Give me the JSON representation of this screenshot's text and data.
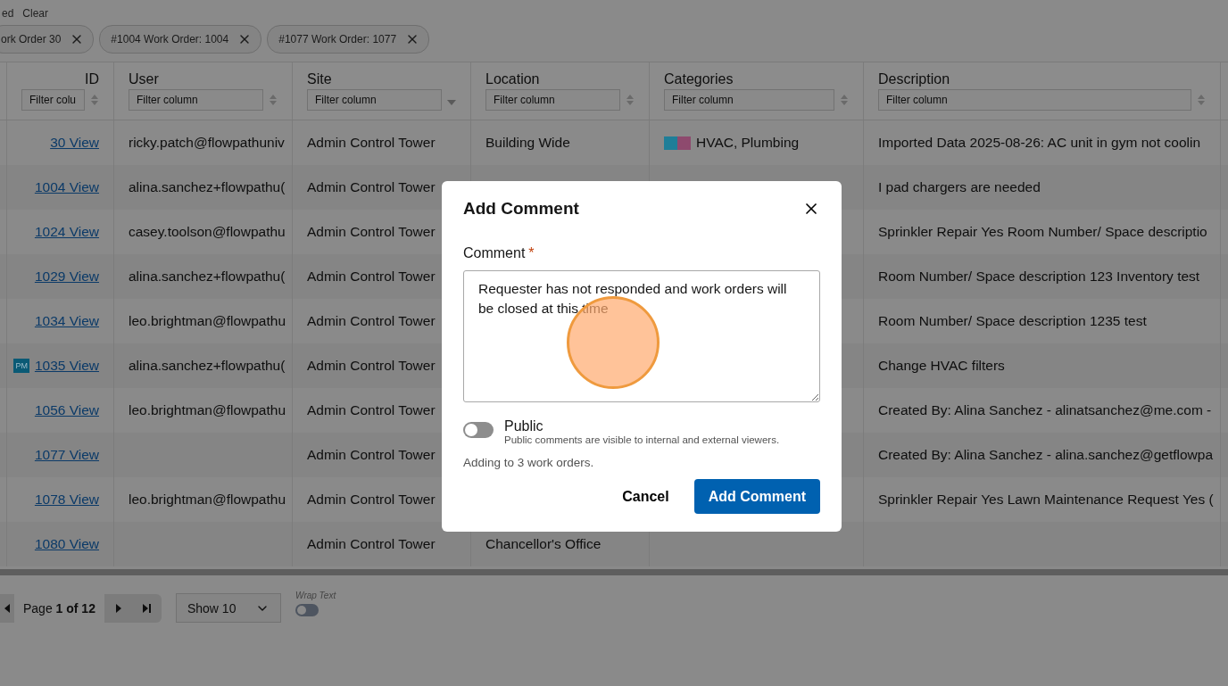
{
  "filter_bar": {
    "label": "ed",
    "clear": "Clear",
    "chips": [
      {
        "label": "ork Order 30"
      },
      {
        "label": "#1004 Work Order: 1004"
      },
      {
        "label": "#1077 Work Order: 1077"
      }
    ]
  },
  "table": {
    "columns": [
      {
        "label": "ID",
        "placeholder": "Filter colu",
        "sorted": false
      },
      {
        "label": "User",
        "placeholder": "Filter column",
        "sorted": false
      },
      {
        "label": "Site",
        "placeholder": "Filter column",
        "sorted": true
      },
      {
        "label": "Location",
        "placeholder": "Filter column",
        "sorted": false
      },
      {
        "label": "Categories",
        "placeholder": "Filter column",
        "sorted": false
      },
      {
        "label": "Description",
        "placeholder": "Filter column",
        "sorted": false
      }
    ],
    "rows": [
      {
        "id": "30 View",
        "user": "ricky.patch@flowpathuniv",
        "site": "Admin Control Tower",
        "location": "Building Wide",
        "categories": {
          "label": "HVAC, Plumbing",
          "swatches": [
            {
              "color": "#1f7e98"
            },
            {
              "color": "#8e4a6e"
            }
          ]
        },
        "description": "Imported Data 2025-08-26: AC unit in gym not coolin"
      },
      {
        "id": "1004 View",
        "user": "alina.sanchez+flowpathu(",
        "site": "Admin Control Tower",
        "description": "I pad chargers are needed"
      },
      {
        "id": "1024 View",
        "user": "casey.toolson@flowpathu",
        "site": "Admin Control Tower",
        "description": "Sprinkler Repair Yes Room Number/ Space descriptio"
      },
      {
        "id": "1029 View",
        "user": "alina.sanchez+flowpathu(",
        "site": "Admin Control Tower",
        "description": "Room Number/ Space description 123 Inventory test"
      },
      {
        "id": "1034 View",
        "user": "leo.brightman@flowpathu",
        "site": "Admin Control Tower",
        "description": "Room Number/ Space description 1235 test"
      },
      {
        "id": "1035 View",
        "badge": "PM",
        "user": "alina.sanchez+flowpathu(",
        "site": "Admin Control Tower",
        "description": "Change HVAC filters"
      },
      {
        "id": "1056 View",
        "user": "leo.brightman@flowpathu",
        "site": "Admin Control Tower",
        "description": "Created By: Alina Sanchez - alinatsanchez@me.com -"
      },
      {
        "id": "1077 View",
        "site": "Admin Control Tower",
        "description": "Created By: Alina Sanchez - alina.sanchez@getflowpa"
      },
      {
        "id": "1078 View",
        "user": "leo.brightman@flowpathu",
        "site": "Admin Control Tower",
        "description": "Sprinkler Repair Yes Lawn Maintenance Request Yes ("
      },
      {
        "id": "1080 View",
        "site": "Admin Control Tower",
        "location": "Chancellor's Office"
      }
    ]
  },
  "pagination": {
    "page": "Page **1 of 12**",
    "show": "Show 10",
    "wrap_label": "Wrap Text",
    "wrap_on": false
  },
  "dialog": {
    "title": "Add Comment",
    "field_label": "Comment",
    "required_mark": "*",
    "value": "Requester has not responded and work orders will be closed at this time",
    "public_label": "Public",
    "public_on": false,
    "public_hint": "Public comments are visible to internal and external viewers.",
    "note": "Adding to 3 work orders.",
    "cancel": "Cancel",
    "submit": "Add Comment"
  }
}
